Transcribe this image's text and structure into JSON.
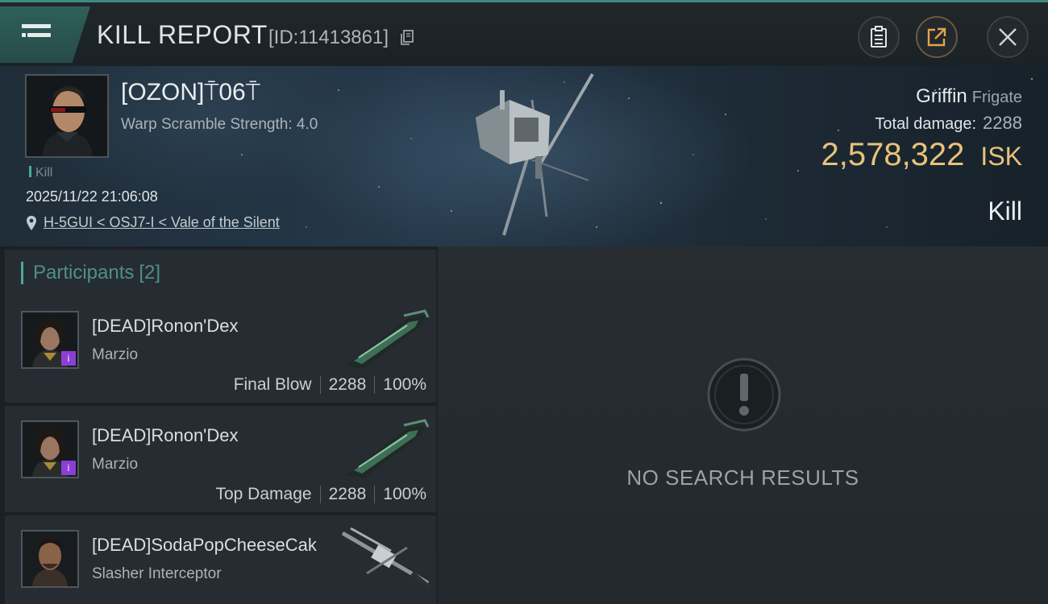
{
  "header": {
    "title": "KILL REPORT",
    "report_id": "[ID:11413861]"
  },
  "victim": {
    "name": "[OZON]⍑06⍑",
    "warp_scramble": "Warp Scramble Strength: 4.0",
    "kill_tag": "Kill",
    "timestamp": "2025/11/22 21:06:08",
    "location": "H-5GUI < OSJ7-I < Vale of the Silent",
    "ship_name": "Griffin",
    "ship_class": "Frigate",
    "total_damage_label": "Total damage:",
    "total_damage": "2288",
    "isk_value": "2,578,322",
    "isk_unit": "ISK",
    "result": "Kill"
  },
  "participants": {
    "label": "Participants",
    "count": "[2]",
    "rows": [
      {
        "name": "[DEAD]Ronon'Dex",
        "ship": "Marzio",
        "role": "Final Blow",
        "damage": "2288",
        "percent": "100%"
      },
      {
        "name": "[DEAD]Ronon'Dex",
        "ship": "Marzio",
        "role": "Top Damage",
        "damage": "2288",
        "percent": "100%"
      },
      {
        "name": "[DEAD]SodaPopCheeseCak",
        "ship": "Slasher Interceptor"
      }
    ]
  },
  "results": {
    "empty_text": "NO SEARCH RESULTS"
  },
  "colors": {
    "accent": "#4aa89d",
    "isk": "#e8c27a"
  }
}
